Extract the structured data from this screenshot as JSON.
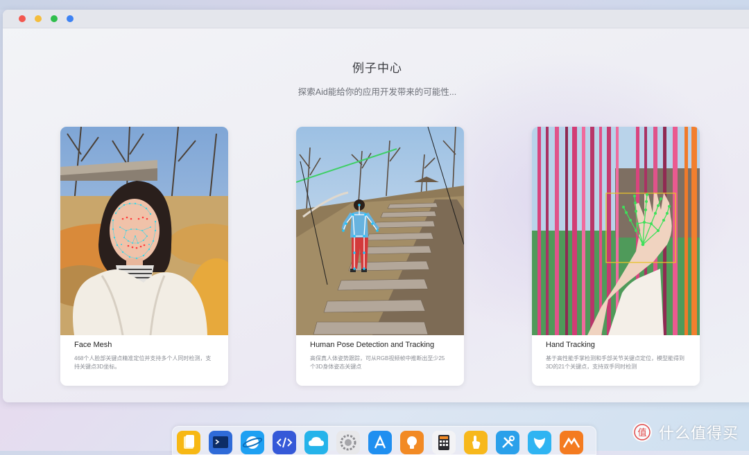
{
  "page": {
    "title": "例子中心",
    "subtitle": "探索Aid能给你的应用开发带来的可能性..."
  },
  "cards": [
    {
      "title": "Face Mesh",
      "description": "468个人脸部关键点精准定位并支持多个人同时检测，支持关键点3D坐标。",
      "image": "woman-face-with-mesh-keypoints"
    },
    {
      "title": "Human Pose Detection and Tracking",
      "description": "高保真人体姿势跟踪，可从RGB视频帧中推断出至少25个3D身体姿态关键点",
      "image": "child-on-stairs-with-pose-skeleton"
    },
    {
      "title": "Hand Tracking",
      "description": "基于高性能手掌检测和手部关节关键点定位，模型能得到3D的21个关键点，支持双手同时检测",
      "image": "hand-with-keypoints-among-pink-poles"
    }
  ],
  "dock": {
    "apps": [
      "files-icon",
      "terminal-icon",
      "browser-icon",
      "code-editor-icon",
      "cloud-icon",
      "settings-icon",
      "app-store-icon",
      "tips-icon",
      "calculator-icon",
      "touch-icon",
      "tools-icon",
      "app-icon",
      "aid-logo-icon"
    ]
  },
  "watermark": {
    "text": "什么值得买",
    "logo_text": "值"
  }
}
